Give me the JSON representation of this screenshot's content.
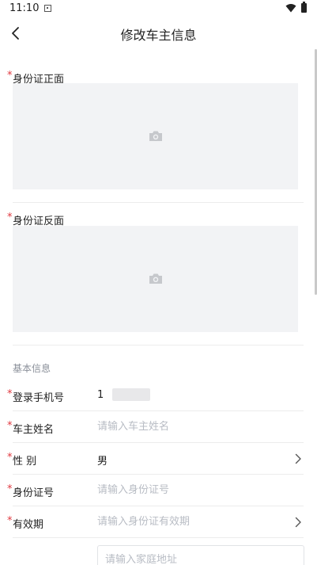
{
  "status_bar": {
    "time": "11:10"
  },
  "nav": {
    "title": "修改车主信息"
  },
  "id_front": {
    "label": "身份证正面",
    "required_mark": "*"
  },
  "id_back": {
    "label": "身份证反面",
    "required_mark": "*"
  },
  "section": {
    "title": "基本信息"
  },
  "rows": [
    {
      "label": "登录手机号",
      "required_mark": "*",
      "value": "1"
    },
    {
      "label": "车主姓名",
      "required_mark": "*",
      "placeholder": "请输入车主姓名"
    },
    {
      "label": "性 别",
      "required_mark": "*",
      "value": "男"
    },
    {
      "label": "身份证号",
      "required_mark": "*",
      "placeholder": "请输入身份证号"
    },
    {
      "label": "有效期",
      "required_mark": "*",
      "placeholder": "请输入身份证有效期"
    }
  ],
  "address": {
    "placeholder": "请输入家庭地址"
  },
  "icons": {
    "back": "chevron-left-icon",
    "camera": "camera-icon",
    "chevron": "chevron-right-icon",
    "wifi": "wifi-icon",
    "battery": "battery-icon"
  },
  "colors": {
    "required": "#e0383e",
    "upload_bg": "#f2f3f5",
    "placeholder": "#b8bcc4",
    "section_title": "#8a8f99"
  }
}
